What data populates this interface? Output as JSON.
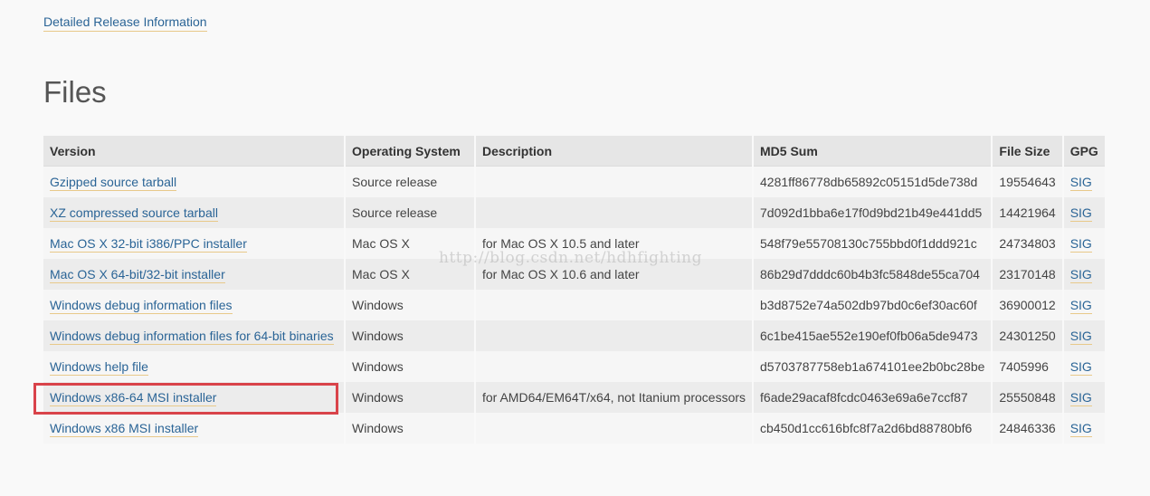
{
  "release_link": "Detailed Release Information",
  "section_title": "Files",
  "watermark": "http://blog.csdn.net/hdhfighting",
  "colors": {
    "link": "#2a6496",
    "link_underline": "#e8c98a",
    "highlight_border": "#d9434a",
    "header_bg": "#e6e6e6"
  },
  "table": {
    "headers": {
      "version": "Version",
      "os": "Operating System",
      "description": "Description",
      "md5": "MD5 Sum",
      "size": "File Size",
      "gpg": "GPG"
    },
    "rows": [
      {
        "version": "Gzipped source tarball",
        "os": "Source release",
        "description": "",
        "md5": "4281ff86778db65892c05151d5de738d",
        "size": "19554643",
        "gpg": "SIG"
      },
      {
        "version": "XZ compressed source tarball",
        "os": "Source release",
        "description": "",
        "md5": "7d092d1bba6e17f0d9bd21b49e441dd5",
        "size": "14421964",
        "gpg": "SIG"
      },
      {
        "version": "Mac OS X 32-bit i386/PPC installer",
        "os": "Mac OS X",
        "description": "for Mac OS X 10.5 and later",
        "md5": "548f79e55708130c755bbd0f1ddd921c",
        "size": "24734803",
        "gpg": "SIG"
      },
      {
        "version": "Mac OS X 64-bit/32-bit installer",
        "os": "Mac OS X",
        "description": "for Mac OS X 10.6 and later",
        "md5": "86b29d7dddc60b4b3fc5848de55ca704",
        "size": "23170148",
        "gpg": "SIG"
      },
      {
        "version": "Windows debug information files",
        "os": "Windows",
        "description": "",
        "md5": "b3d8752e74a502db97bd0c6ef30ac60f",
        "size": "36900012",
        "gpg": "SIG"
      },
      {
        "version": "Windows debug information files for 64-bit binaries",
        "os": "Windows",
        "description": "",
        "md5": "6c1be415ae552e190ef0fb06a5de9473",
        "size": "24301250",
        "gpg": "SIG"
      },
      {
        "version": "Windows help file",
        "os": "Windows",
        "description": "",
        "md5": "d5703787758eb1a674101ee2b0bc28be",
        "size": "7405996",
        "gpg": "SIG"
      },
      {
        "version": "Windows x86-64 MSI installer",
        "os": "Windows",
        "description": "for AMD64/EM64T/x64, not Itanium processors",
        "md5": "f6ade29acaf8fcdc0463e69a6e7ccf87",
        "size": "25550848",
        "gpg": "SIG"
      },
      {
        "version": "Windows x86 MSI installer",
        "os": "Windows",
        "description": "",
        "md5": "cb450d1cc616bfc8f7a2d6bd88780bf6",
        "size": "24846336",
        "gpg": "SIG"
      }
    ]
  }
}
